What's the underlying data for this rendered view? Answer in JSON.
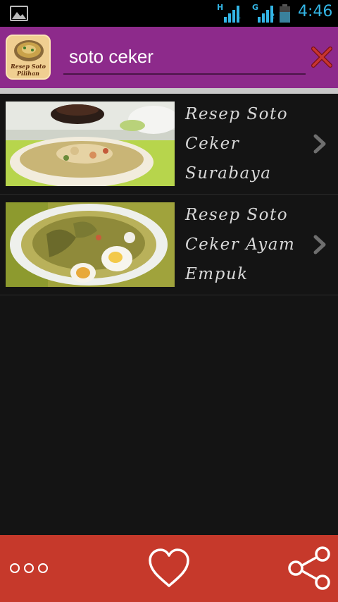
{
  "status_bar": {
    "time": "4:46",
    "network_1": "H",
    "sim_1": "1",
    "network_2": "G",
    "sim_2": "2",
    "icons": [
      "gallery-icon",
      "signal-icon",
      "signal-icon",
      "battery-icon"
    ]
  },
  "header": {
    "logo_line1": "Resep Soto",
    "logo_line2": "Pilihan",
    "search_value": "soto ceker",
    "clear_icon": "close-icon"
  },
  "results": [
    {
      "line1": "Resep Soto",
      "line2": "Ceker",
      "line3": "Surabaya",
      "icon": "chevron-right-icon"
    },
    {
      "line1": "Resep Soto",
      "line2": "Ceker Ayam",
      "line3": "Empuk",
      "icon": "chevron-right-icon"
    }
  ],
  "bottom_bar": {
    "icons": [
      "more-icon",
      "heart-icon",
      "share-icon"
    ]
  },
  "colors": {
    "action_bar": "#8d2a8b",
    "bottom_bar": "#c6392b",
    "status_accent": "#33b5e5",
    "background": "#141414"
  }
}
